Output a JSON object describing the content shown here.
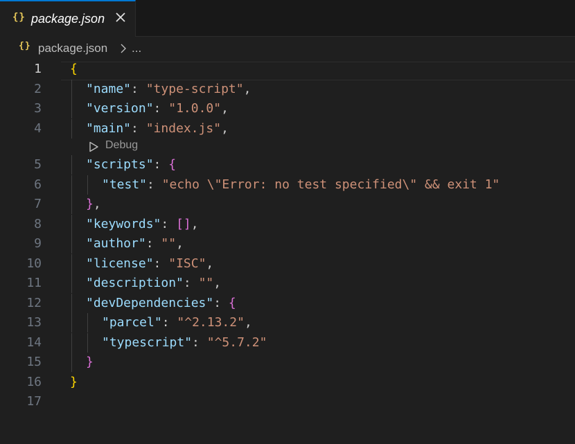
{
  "tab": {
    "label": "package.json",
    "icon": "{}"
  },
  "breadcrumb": {
    "icon": "{}",
    "file": "package.json",
    "more": "..."
  },
  "codelens": {
    "label": "Debug"
  },
  "lines": [
    {
      "n": "1",
      "tokens": [
        [
          "b1",
          "{"
        ]
      ]
    },
    {
      "n": "2",
      "tokens": [
        [
          "k",
          "\"name\""
        ],
        [
          "p",
          ": "
        ],
        [
          "s",
          "\"type-script\""
        ],
        [
          "p",
          ","
        ]
      ]
    },
    {
      "n": "3",
      "tokens": [
        [
          "k",
          "\"version\""
        ],
        [
          "p",
          ": "
        ],
        [
          "s",
          "\"1.0.0\""
        ],
        [
          "p",
          ","
        ]
      ]
    },
    {
      "n": "4",
      "tokens": [
        [
          "k",
          "\"main\""
        ],
        [
          "p",
          ": "
        ],
        [
          "s",
          "\"index.js\""
        ],
        [
          "p",
          ","
        ]
      ]
    },
    {
      "n": "5",
      "tokens": [
        [
          "k",
          "\"scripts\""
        ],
        [
          "p",
          ": "
        ],
        [
          "b2",
          "{"
        ]
      ]
    },
    {
      "n": "6",
      "tokens": [
        [
          "k",
          "\"test\""
        ],
        [
          "p",
          ": "
        ],
        [
          "s",
          "\"echo \\\"Error: no test specified\\\" && exit 1\""
        ]
      ]
    },
    {
      "n": "7",
      "tokens": [
        [
          "b2",
          "}"
        ],
        [
          "p",
          ","
        ]
      ]
    },
    {
      "n": "8",
      "tokens": [
        [
          "k",
          "\"keywords\""
        ],
        [
          "p",
          ": "
        ],
        [
          "b2",
          "[]"
        ],
        [
          "p",
          ","
        ]
      ]
    },
    {
      "n": "9",
      "tokens": [
        [
          "k",
          "\"author\""
        ],
        [
          "p",
          ": "
        ],
        [
          "s",
          "\"\""
        ],
        [
          "p",
          ","
        ]
      ]
    },
    {
      "n": "10",
      "tokens": [
        [
          "k",
          "\"license\""
        ],
        [
          "p",
          ": "
        ],
        [
          "s",
          "\"ISC\""
        ],
        [
          "p",
          ","
        ]
      ]
    },
    {
      "n": "11",
      "tokens": [
        [
          "k",
          "\"description\""
        ],
        [
          "p",
          ": "
        ],
        [
          "s",
          "\"\""
        ],
        [
          "p",
          ","
        ]
      ]
    },
    {
      "n": "12",
      "tokens": [
        [
          "k",
          "\"devDependencies\""
        ],
        [
          "p",
          ": "
        ],
        [
          "b2",
          "{"
        ]
      ]
    },
    {
      "n": "13",
      "tokens": [
        [
          "k",
          "\"parcel\""
        ],
        [
          "p",
          ": "
        ],
        [
          "s",
          "\"^2.13.2\""
        ],
        [
          "p",
          ","
        ]
      ]
    },
    {
      "n": "14",
      "tokens": [
        [
          "k",
          "\"typescript\""
        ],
        [
          "p",
          ": "
        ],
        [
          "s",
          "\"^5.7.2\""
        ]
      ]
    },
    {
      "n": "15",
      "tokens": [
        [
          "b2",
          "}"
        ]
      ]
    },
    {
      "n": "16",
      "tokens": [
        [
          "b1",
          "}"
        ]
      ]
    },
    {
      "n": "17",
      "tokens": []
    }
  ],
  "colors": {
    "key": "#9cdcfe",
    "string": "#ce9178",
    "punct": "#cccccc",
    "bracket1": "#ffd700",
    "bracket2": "#da70d6",
    "line_number": "#6e7681"
  }
}
